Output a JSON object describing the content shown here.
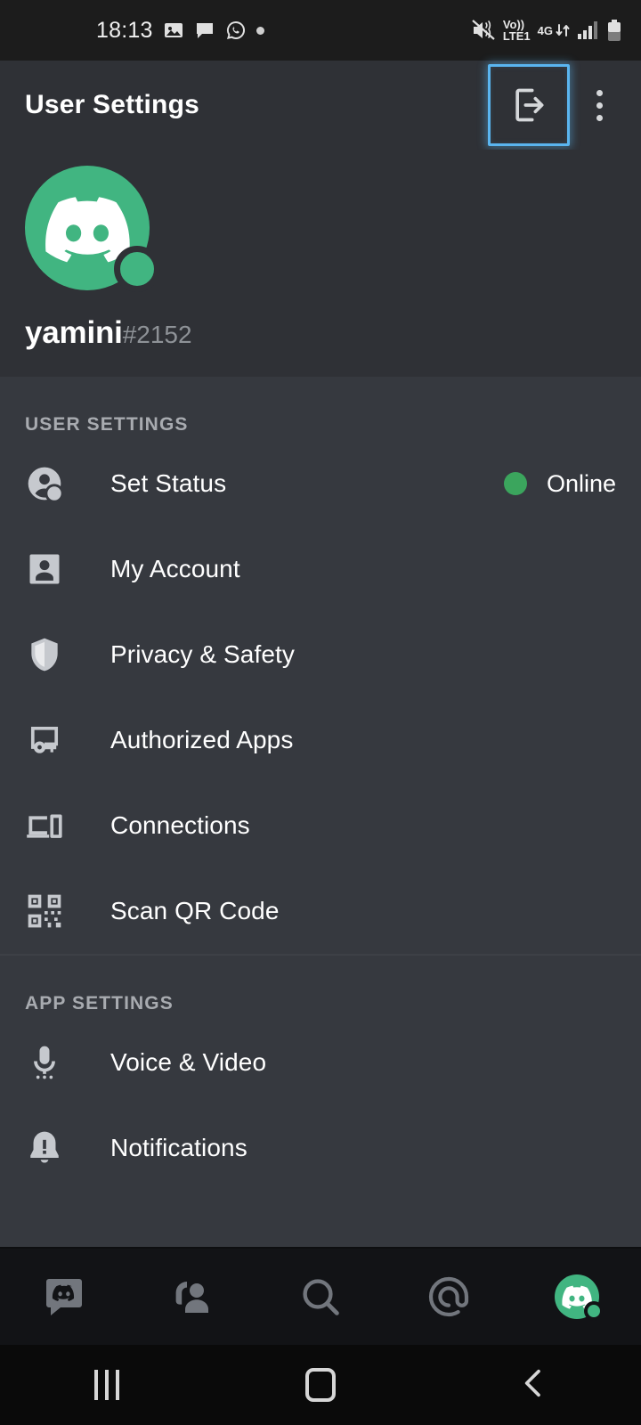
{
  "status_bar": {
    "time": "18:13",
    "left_icons": [
      "image-icon",
      "chat-bubble-icon",
      "whatsapp-icon",
      "dot-indicator-icon"
    ],
    "network_label_top": "Vo))",
    "network_label_bottom": "LTE1",
    "network_type": "4G",
    "right_icons": [
      "mute-icon",
      "volte-icon",
      "data-transfer-icon",
      "signal-bars-icon",
      "battery-icon"
    ]
  },
  "header": {
    "title": "User Settings",
    "logout_icon": "logout-icon",
    "overflow_icon": "kebab-menu-icon",
    "highlight_color": "#5ab5f0"
  },
  "profile": {
    "avatar_icon": "discord-clyde-avatar",
    "avatar_color": "#41b581",
    "username": "yamini",
    "discriminator": "#2152",
    "presence": "online",
    "presence_color": "#41b581"
  },
  "sections": [
    {
      "title": "USER SETTINGS",
      "items": [
        {
          "label": "Set Status",
          "icon": "set-status-icon",
          "value": "Online",
          "value_dot_color": "#3ba55d"
        },
        {
          "label": "My Account",
          "icon": "account-icon"
        },
        {
          "label": "Privacy & Safety",
          "icon": "shield-icon"
        },
        {
          "label": "Authorized Apps",
          "icon": "authorized-apps-icon"
        },
        {
          "label": "Connections",
          "icon": "connections-icon"
        },
        {
          "label": "Scan QR Code",
          "icon": "qr-code-icon"
        }
      ]
    },
    {
      "title": "APP SETTINGS",
      "items": [
        {
          "label": "Voice & Video",
          "icon": "microphone-icon"
        },
        {
          "label": "Notifications",
          "icon": "bell-alert-icon"
        }
      ]
    }
  ],
  "tabbar": {
    "items": [
      {
        "name": "servers-tab",
        "icon": "discord-bubble-icon"
      },
      {
        "name": "friends-tab",
        "icon": "friends-headset-icon"
      },
      {
        "name": "search-tab",
        "icon": "search-icon"
      },
      {
        "name": "mentions-tab",
        "icon": "at-mention-icon"
      },
      {
        "name": "profile-tab",
        "icon": "user-avatar-icon"
      }
    ]
  },
  "navbar": {
    "recents": "recents-icon",
    "home": "home-icon",
    "back": "back-icon"
  },
  "colors": {
    "header_bg": "#2f3136",
    "list_bg": "#36393f",
    "tabbar_bg": "#121316",
    "accent_green": "#41b581"
  }
}
